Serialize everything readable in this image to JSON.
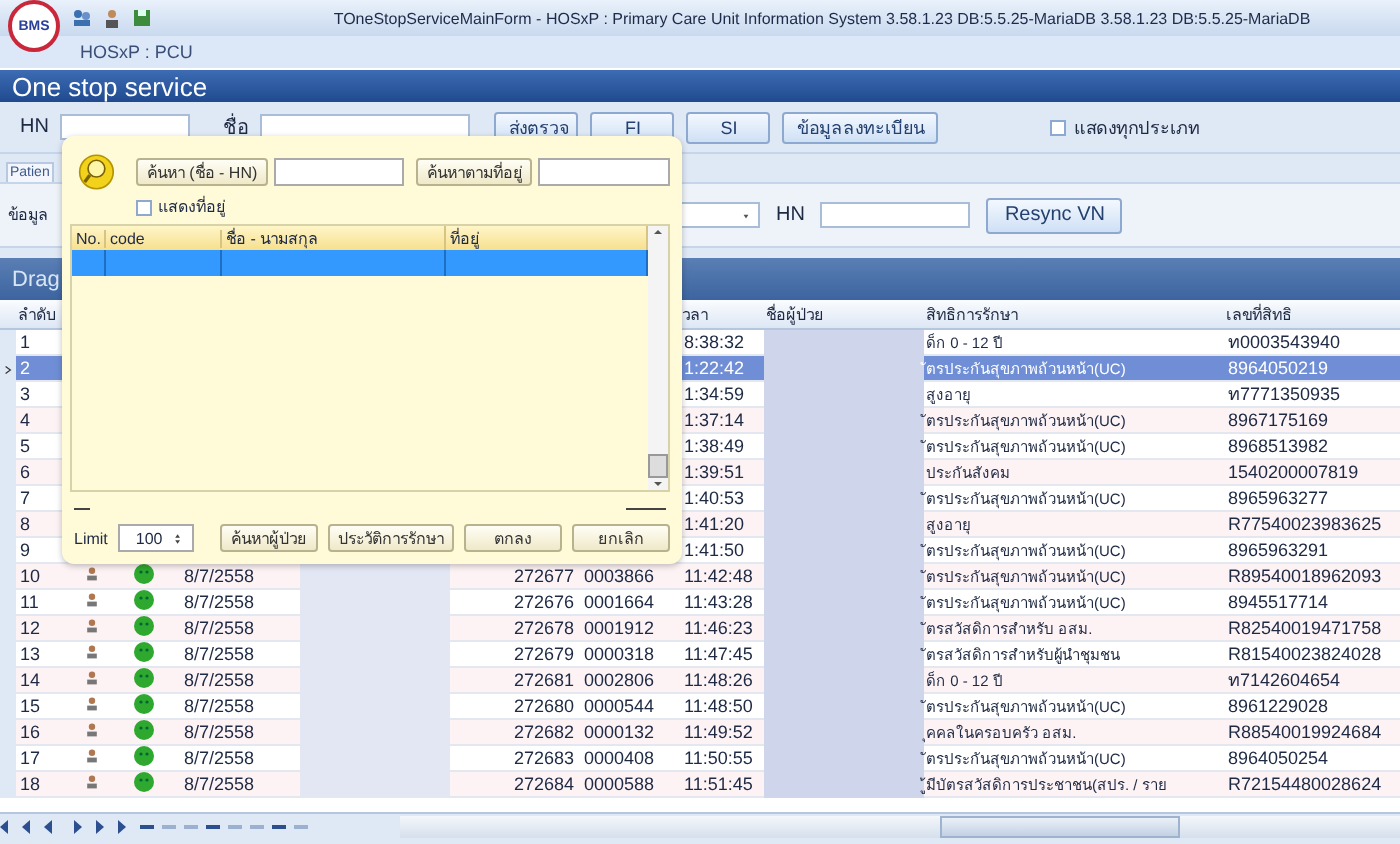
{
  "window": {
    "title": "TOneStopServiceMainForm - HOSxP : Primary Care Unit Information System 3.58.1.23 DB:5.5.25-MariaDB 3.58.1.23 DB:5.5.25-MariaDB",
    "logo_text": "BMS",
    "app_label": "HOSxP : PCU"
  },
  "header": {
    "title": "One stop service"
  },
  "toolbar": {
    "hn_label": "HN",
    "name_label": "ชื่อ",
    "buttons": [
      "ส่งตรวจ",
      "FI",
      "SI",
      "ข้อมูลลงทะเบียน"
    ],
    "show_all": {
      "label": "แสดงทุกประเภท",
      "checked": false
    }
  },
  "tabs": [
    {
      "label": "Patien",
      "selected": true
    }
  ],
  "filter": {
    "label": "ข้อมูล",
    "hn_label": "HN",
    "button": "Resync VN"
  },
  "group_panel": {
    "text": "Drag"
  },
  "table": {
    "columns": [
      {
        "label": "ลำดับ"
      },
      {
        "label": "วลา"
      },
      {
        "label": "ชื่อผู้ป่วย"
      },
      {
        "label": "สิทธิการรักษา"
      },
      {
        "label": "เลขที่สิทธิ"
      }
    ],
    "rows": [
      {
        "no": "1",
        "kind": "covered",
        "time": "8:38:32",
        "right": "ด็ก 0 - 12 ปี",
        "right_no": "ท0003543940",
        "selected": false
      },
      {
        "no": "2",
        "kind": "covered",
        "time": "1:22:42",
        "right": "ัตรประกันสุขภาพถ้วนหน้า(UC)",
        "right_no": "8964050219",
        "selected": true
      },
      {
        "no": "3",
        "kind": "covered",
        "time": "1:34:59",
        "right": "สูงอายุ",
        "right_no": "ท7771350935",
        "selected": false
      },
      {
        "no": "4",
        "kind": "covered",
        "time": "1:37:14",
        "right": "ัตรประกันสุขภาพถ้วนหน้า(UC)",
        "right_no": "8967175169",
        "selected": false
      },
      {
        "no": "5",
        "kind": "covered",
        "time": "1:38:49",
        "right": "ัตรประกันสุขภาพถ้วนหน้า(UC)",
        "right_no": "8968513982",
        "selected": false
      },
      {
        "no": "6",
        "kind": "covered",
        "time": "1:39:51",
        "right": "ประกันสังคม",
        "right_no": "1540200007819",
        "selected": false
      },
      {
        "no": "7",
        "kind": "covered",
        "time": "1:40:53",
        "right": "ัตรประกันสุขภาพถ้วนหน้า(UC)",
        "right_no": "8965963277",
        "selected": false
      },
      {
        "no": "8",
        "kind": "covered",
        "time": "1:41:20",
        "right": "สูงอายุ",
        "right_no": "R77540023983625",
        "selected": false
      },
      {
        "no": "9",
        "kind": "covered",
        "time": "1:41:50",
        "right": "ัตรประกันสุขภาพถ้วนหน้า(UC)",
        "right_no": "8965963291",
        "selected": false
      },
      {
        "no": "10",
        "kind": "full",
        "date": "8/7/2558",
        "vn": "272677",
        "hn": "0003866",
        "time": "11:42:48",
        "right": "ัตรประกันสุขภาพถ้วนหน้า(UC)",
        "right_no": "R89540018962093",
        "selected": false
      },
      {
        "no": "11",
        "kind": "full",
        "date": "8/7/2558",
        "vn": "272676",
        "hn": "0001664",
        "time": "11:43:28",
        "right": "ัตรประกันสุขภาพถ้วนหน้า(UC)",
        "right_no": "8945517714",
        "selected": false
      },
      {
        "no": "12",
        "kind": "full",
        "date": "8/7/2558",
        "vn": "272678",
        "hn": "0001912",
        "time": "11:46:23",
        "right": "ัตรสวัสดิการสำหรับ อสม.",
        "right_no": "R82540019471758",
        "selected": false
      },
      {
        "no": "13",
        "kind": "full",
        "date": "8/7/2558",
        "vn": "272679",
        "hn": "0000318",
        "time": "11:47:45",
        "right": "ัตรสวัสดิการสำหรับผู้นำชุมชน",
        "right_no": "R81540023824028",
        "selected": false
      },
      {
        "no": "14",
        "kind": "full",
        "date": "8/7/2558",
        "vn": "272681",
        "hn": "0002806",
        "time": "11:48:26",
        "right": "ด็ก 0 - 12 ปี",
        "right_no": "ท7142604654",
        "selected": false
      },
      {
        "no": "15",
        "kind": "full",
        "date": "8/7/2558",
        "vn": "272680",
        "hn": "0000544",
        "time": "11:48:50",
        "right": "ัตรประกันสุขภาพถ้วนหน้า(UC)",
        "right_no": "8961229028",
        "selected": false
      },
      {
        "no": "16",
        "kind": "full",
        "date": "8/7/2558",
        "vn": "272682",
        "hn": "0000132",
        "time": "11:49:52",
        "right": "ุคคลในครอบครัว อสม.",
        "right_no": "R88540019924684",
        "selected": false
      },
      {
        "no": "17",
        "kind": "full",
        "date": "8/7/2558",
        "vn": "272683",
        "hn": "0000408",
        "time": "11:50:55",
        "right": "ัตรประกันสุขภาพถ้วนหน้า(UC)",
        "right_no": "8964050254",
        "selected": false
      },
      {
        "no": "18",
        "kind": "full",
        "date": "8/7/2558",
        "vn": "272684",
        "hn": "0000588",
        "time": "11:51:45",
        "right": "ู้มีบัตรสวัสดิการประชาชน(สปร. / ราย",
        "right_no": "R72154480028624",
        "selected": false
      }
    ]
  },
  "popup": {
    "search_button": "ค้นหา (ชื่อ - HN)",
    "address_button": "ค้นหาตามที่อยู่",
    "show_address": {
      "label": "แสดงที่อยู่",
      "checked": false
    },
    "columns": [
      "No.",
      "code",
      "ชื่อ - นามสกุล",
      "ที่อยู่"
    ],
    "rows": [
      {
        "selected": true
      }
    ],
    "limit_label": "Limit",
    "limit_value": "100",
    "buttons": [
      "ค้นหาผู้ป่วย",
      "ประวัติการรักษา",
      "ตกลง",
      "ยกเลิก"
    ]
  }
}
